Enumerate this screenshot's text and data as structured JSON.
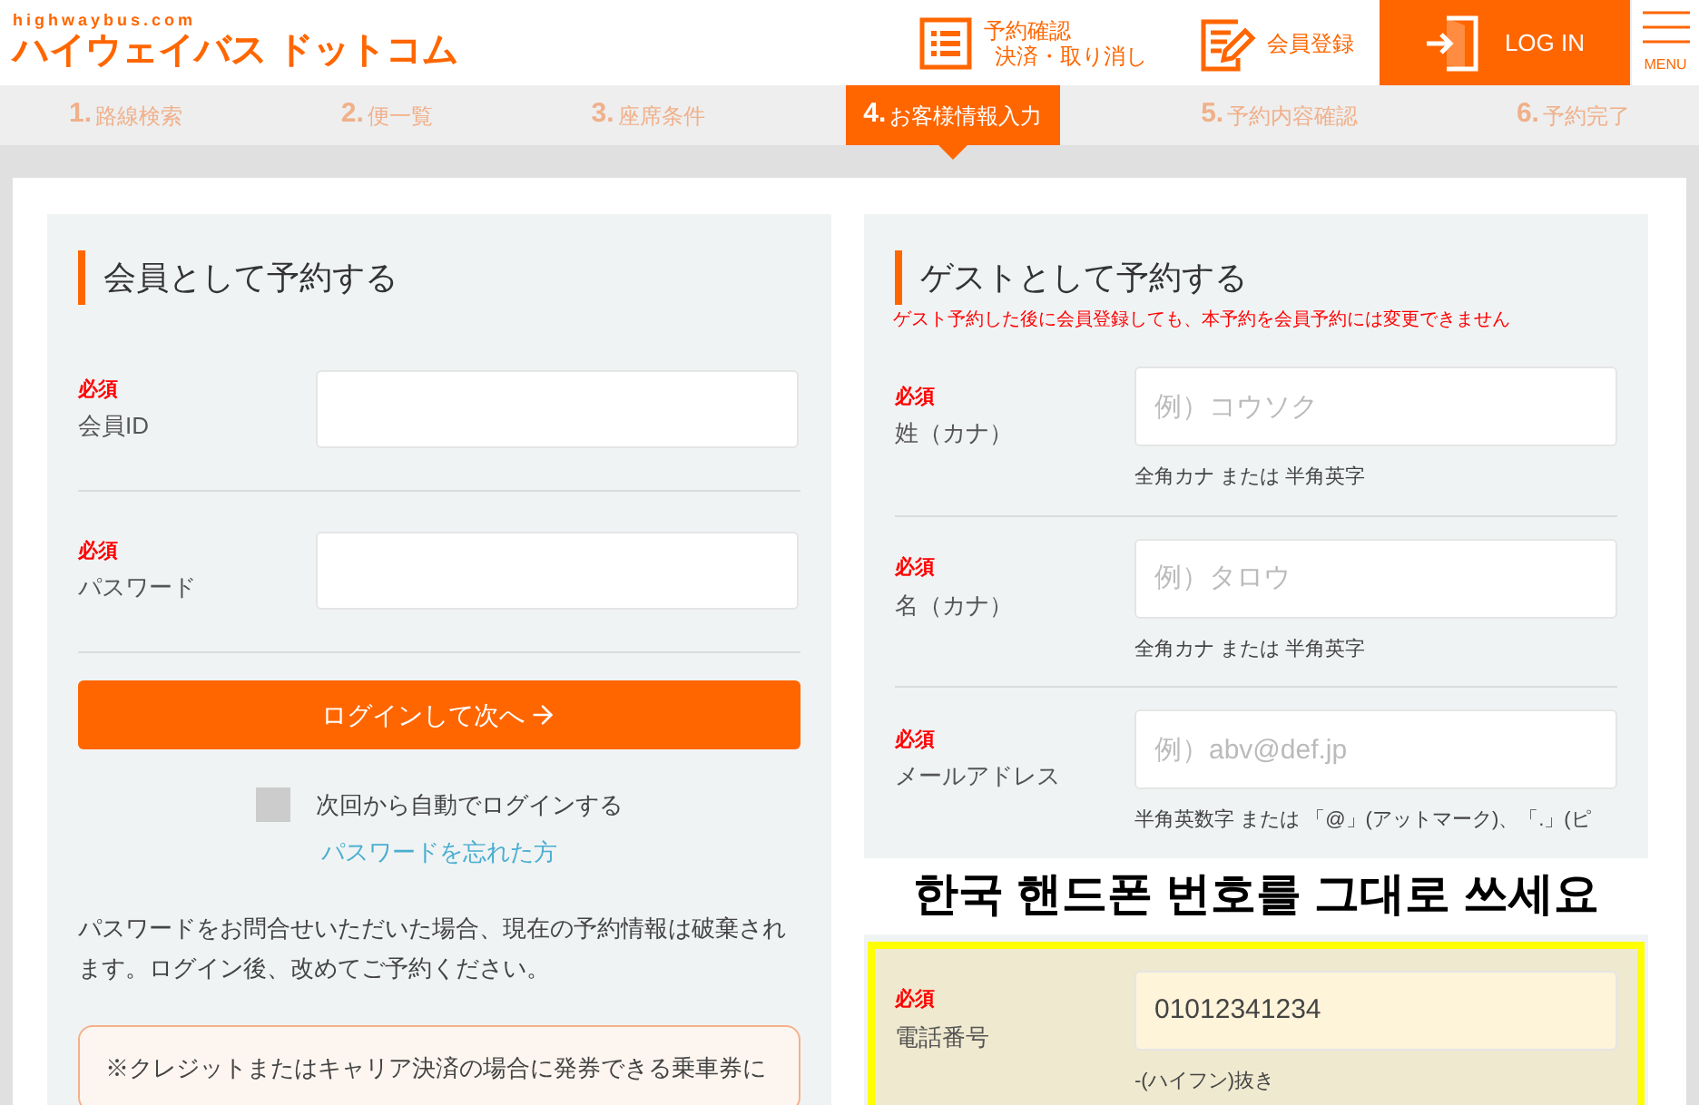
{
  "header": {
    "logo_small": "highwaybus.com",
    "logo": "ハイウェイバス ドットコム",
    "nav": [
      {
        "kind": "list",
        "lines": [
          "予約確認",
          "決済・取り消し"
        ]
      },
      {
        "kind": "pencil",
        "lines": [
          "会員登録"
        ]
      }
    ],
    "login_button": "LOG IN",
    "menu_label": "MENU"
  },
  "steps": [
    {
      "number": "1.",
      "label": "路線検索",
      "selected": false
    },
    {
      "number": "2.",
      "label": "便一覧",
      "selected": false
    },
    {
      "number": "3.",
      "label": "座席条件",
      "selected": false
    },
    {
      "number": "4.",
      "label": "お客様情報入力",
      "selected": true
    },
    {
      "number": "5.",
      "label": "予約内容確認",
      "selected": false
    },
    {
      "number": "6.",
      "label": "予約完了",
      "selected": false
    }
  ],
  "member_panel": {
    "title": "会員として予約する",
    "fields": [
      {
        "required": "必須",
        "label": "会員ID"
      },
      {
        "required": "必須",
        "label": "パスワード"
      }
    ],
    "login_button": "ログインして次へ",
    "auto_login": {
      "label": "次回から自動でログインする",
      "checked": false
    },
    "forgot_link": "パスワードを忘れた方",
    "note": "パスワードをお問合せいただいた場合、現在の予約情報は破棄されます。ログイン後、改めてご予約ください。",
    "notice": "※クレジットまたはキャリア決済の場合に発券できる乗車券に"
  },
  "guest_panel": {
    "title": "ゲストとして予約する",
    "warning": "ゲスト予約した後に会員登録しても、本予約を会員予約には変更できません",
    "fields": [
      {
        "required": "必須",
        "label": "姓（カナ）",
        "placeholder": "例）コウソク",
        "hint": "全角カナ または 半角英字",
        "highlighted": false
      },
      {
        "required": "必須",
        "label": "名（カナ）",
        "placeholder": "例）タロウ",
        "hint": "全角カナ または 半角英字",
        "highlighted": false
      },
      {
        "required": "必須",
        "label": "メールアドレス",
        "placeholder": "例）abv@def.jp",
        "hint": "半角英数字 または 「@」(アットマーク)、「.」(ピ",
        "highlighted": false
      },
      {
        "required": "必須",
        "label": "電話番号",
        "value": "01012341234",
        "hint": "-(ハイフン)抜き",
        "highlighted": true,
        "annotation": "한국 핸드폰 번호를 그대로 쓰세요"
      }
    ]
  }
}
